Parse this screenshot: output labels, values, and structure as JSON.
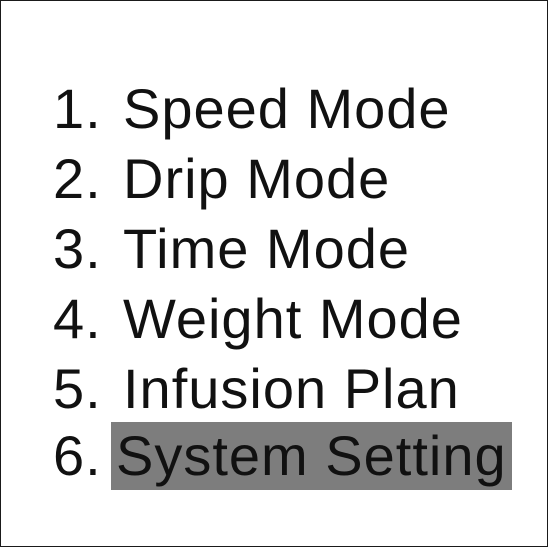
{
  "menu": {
    "items": [
      {
        "number": "1.",
        "label": "Speed Mode",
        "selected": false
      },
      {
        "number": "2.",
        "label": "Drip Mode",
        "selected": false
      },
      {
        "number": "3.",
        "label": "Time Mode",
        "selected": false
      },
      {
        "number": "4.",
        "label": "Weight Mode",
        "selected": false
      },
      {
        "number": "5.",
        "label": "Infusion Plan",
        "selected": false
      },
      {
        "number": "6.",
        "label": "System Setting",
        "selected": true
      }
    ],
    "highlight_color": "#7d7d7d"
  }
}
